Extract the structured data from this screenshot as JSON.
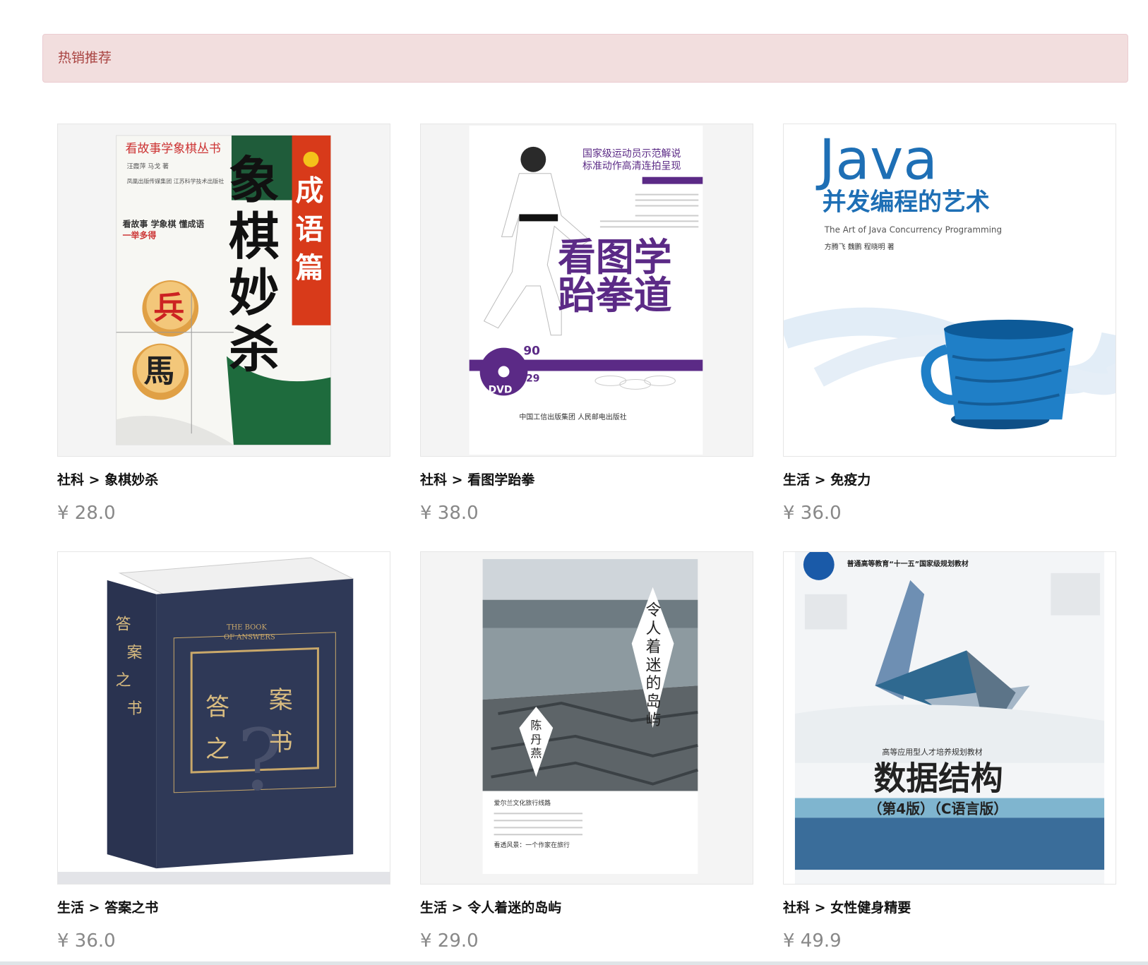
{
  "section": {
    "title": "热销推荐"
  },
  "products": [
    {
      "category": "社科",
      "separator": ">",
      "name": "象棋妙杀",
      "price": "¥ 28.0",
      "cover": {
        "series": "看故事学象棋丛书",
        "authors": "汪霞萍 马戈 著",
        "publisher": "凤凰出版传媒集团 江苏科学技术出版社",
        "tagline": "看故事 学象棋 懂成语",
        "tagline2": "一举多得",
        "main": "象棋妙杀",
        "side": "成语篇",
        "piece1": "兵",
        "piece2": "馬"
      }
    },
    {
      "category": "社科",
      "separator": ">",
      "name": "看图学跆拳",
      "price": "¥ 38.0",
      "cover": {
        "line1": "国家级运动员示范解说",
        "line2": "标准动作高清连拍呈现",
        "title1": "看图学",
        "title2": "跆拳道",
        "dvd": "DVD",
        "n90": "90",
        "n929": "929",
        "publisher": "中国工信出版集团 人民邮电出版社"
      }
    },
    {
      "category": "生活",
      "separator": ">",
      "name": "免疫力",
      "price": "¥ 36.0",
      "cover": {
        "title": "Java",
        "subtitle": "并发编程的艺术",
        "en": "The Art of Java Concurrency Programming",
        "authors": "方腾飞 魏鹏 程晓明 著"
      }
    },
    {
      "category": "生活",
      "separator": ">",
      "name": "答案之书",
      "price": "¥ 36.0",
      "cover": {
        "c1": "答",
        "c2": "案",
        "c3": "之",
        "c4": "书",
        "spine": "答案之书",
        "en1": "THE BOOK",
        "en2": "OF ANSWERS"
      }
    },
    {
      "category": "生活",
      "separator": ">",
      "name": "令人着迷的岛屿",
      "price": "¥ 29.0",
      "cover": {
        "title": "令人着迷的岛屿",
        "author": "陈丹燕",
        "series": "爱尔兰文化旅行线路",
        "footer": "看透风景：一个作家在旅行"
      }
    },
    {
      "category": "社科",
      "separator": ">",
      "name": "女性健身精要",
      "price": "¥ 49.9",
      "cover": {
        "top": "普通高等教育“十一五”国家级规划教材",
        "series": "高等应用型人才培养规划教材",
        "title": "数据结构",
        "edition": "（第4版）（C语言版）"
      }
    }
  ],
  "colors": {
    "banner_bg": "#f2dede",
    "banner_text": "#a94442",
    "price": "#888888"
  }
}
